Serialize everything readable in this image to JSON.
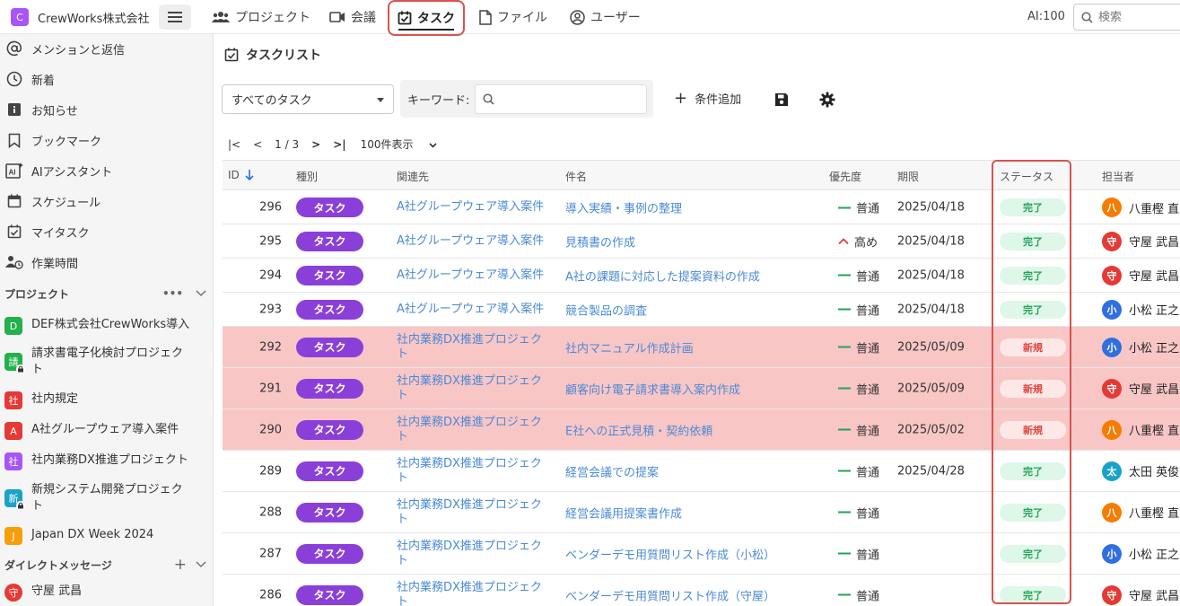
{
  "app": {
    "org_initial": "C",
    "org_name": "CrewWorks株式会社",
    "ai_count": "AI:100",
    "search_placeholder": "検索"
  },
  "topnav": {
    "project": "プロジェクト",
    "meeting": "会議",
    "task": "タスク",
    "file": "ファイル",
    "user": "ユーザー"
  },
  "sidebar": {
    "items": [
      {
        "label": "メンションと返信",
        "icon": "at-icon"
      },
      {
        "label": "新着",
        "icon": "clock-icon"
      },
      {
        "label": "お知らせ",
        "icon": "info-icon"
      },
      {
        "label": "ブックマーク",
        "icon": "bookmark-icon"
      },
      {
        "label": "AIアシスタント",
        "icon": "ai-assistant-icon"
      },
      {
        "label": "スケジュール",
        "icon": "calendar-icon"
      },
      {
        "label": "マイタスク",
        "icon": "task-icon"
      },
      {
        "label": "作業時間",
        "icon": "work-time-icon"
      }
    ],
    "projects_heading": "プロジェクト",
    "projects": [
      {
        "initial": "D",
        "label": "DEF株式会社CrewWorks導入",
        "color": "#22b14c",
        "locked": false
      },
      {
        "initial": "請",
        "label": "請求書電子化検討プロジェクト",
        "color": "#22b14c",
        "locked": true
      },
      {
        "initial": "社",
        "label": "社内規定",
        "color": "#e53935",
        "locked": false
      },
      {
        "initial": "A",
        "label": "A社グループウェア導入案件",
        "color": "#e53935",
        "locked": false
      },
      {
        "initial": "社",
        "label": "社内業務DX推進プロジェクト",
        "color": "#a855f7",
        "locked": false
      },
      {
        "initial": "新",
        "label": "新規システム開発プロジェクト",
        "color": "#1aa3c8",
        "locked": true
      },
      {
        "initial": "J",
        "label": "Japan DX Week 2024",
        "color": "#f59e0b",
        "locked": false
      }
    ],
    "dm_heading": "ダイレクトメッセージ",
    "dm": [
      {
        "initial": "守",
        "label": "守屋 武昌",
        "color": "#e53935"
      }
    ]
  },
  "main": {
    "title": "タスクリスト",
    "filter_value": "すべてのタスク",
    "keyword_label": "キーワード:",
    "add_condition": "条件追加",
    "pager": {
      "first": "|<",
      "prev": "<",
      "page": "1 / 3",
      "next": ">",
      "last": ">|",
      "per_page": "100件表示"
    }
  },
  "table": {
    "headers": {
      "id": "ID",
      "type": "種別",
      "related": "関連先",
      "title": "件名",
      "priority": "優先度",
      "deadline": "期限",
      "status": "ステータス",
      "assignee": "担当者"
    },
    "rows": [
      {
        "id": "296",
        "type": "タスク",
        "related": "A社グループウェア導入案件",
        "title": "導入実績・事例の整理",
        "priority": "普通",
        "priority_level": "normal",
        "deadline": "2025/04/18",
        "status": "完了",
        "status_kind": "done",
        "assignee_initial": "八",
        "assignee": "八重樫 直",
        "avatar_color": "#f57c00",
        "highlight": false
      },
      {
        "id": "295",
        "type": "タスク",
        "related": "A社グループウェア導入案件",
        "title": "見積書の作成",
        "priority": "高め",
        "priority_level": "high",
        "deadline": "2025/04/18",
        "status": "完了",
        "status_kind": "done",
        "assignee_initial": "守",
        "assignee": "守屋 武昌",
        "avatar_color": "#e53935",
        "highlight": false
      },
      {
        "id": "294",
        "type": "タスク",
        "related": "A社グループウェア導入案件",
        "title": "A社の課題に対応した提案資料の作成",
        "priority": "普通",
        "priority_level": "normal",
        "deadline": "2025/04/18",
        "status": "完了",
        "status_kind": "done",
        "assignee_initial": "守",
        "assignee": "守屋 武昌",
        "avatar_color": "#e53935",
        "highlight": false
      },
      {
        "id": "293",
        "type": "タスク",
        "related": "A社グループウェア導入案件",
        "title": "競合製品の調査",
        "priority": "普通",
        "priority_level": "normal",
        "deadline": "2025/04/18",
        "status": "完了",
        "status_kind": "done",
        "assignee_initial": "小",
        "assignee": "小松 正之",
        "avatar_color": "#2f6fe0",
        "highlight": false
      },
      {
        "id": "292",
        "type": "タスク",
        "related": "社内業務DX推進プロジェクト",
        "title": "社内マニュアル作成計画",
        "priority": "普通",
        "priority_level": "normal",
        "deadline": "2025/05/09",
        "status": "新規",
        "status_kind": "new",
        "assignee_initial": "小",
        "assignee": "小松 正之",
        "avatar_color": "#2f6fe0",
        "highlight": true
      },
      {
        "id": "291",
        "type": "タスク",
        "related": "社内業務DX推進プロジェクト",
        "title": "顧客向け電子請求書導入案内作成",
        "priority": "普通",
        "priority_level": "normal",
        "deadline": "2025/05/09",
        "status": "新規",
        "status_kind": "new",
        "assignee_initial": "守",
        "assignee": "守屋 武昌",
        "avatar_color": "#e53935",
        "highlight": true
      },
      {
        "id": "290",
        "type": "タスク",
        "related": "社内業務DX推進プロジェクト",
        "title": "E社への正式見積・契約依頼",
        "priority": "普通",
        "priority_level": "normal",
        "deadline": "2025/05/02",
        "status": "新規",
        "status_kind": "new",
        "assignee_initial": "八",
        "assignee": "八重樫 直",
        "avatar_color": "#f57c00",
        "highlight": true
      },
      {
        "id": "289",
        "type": "タスク",
        "related": "社内業務DX推進プロジェクト",
        "title": "経営会議での提案",
        "priority": "普通",
        "priority_level": "normal",
        "deadline": "2025/04/28",
        "status": "完了",
        "status_kind": "done",
        "assignee_initial": "太",
        "assignee": "太田 英俊",
        "avatar_color": "#1aa3c8",
        "highlight": false
      },
      {
        "id": "288",
        "type": "タスク",
        "related": "社内業務DX推進プロジェクト",
        "title": "経営会議用提案書作成",
        "priority": "普通",
        "priority_level": "normal",
        "deadline": "",
        "status": "完了",
        "status_kind": "done",
        "assignee_initial": "八",
        "assignee": "八重樫 直",
        "avatar_color": "#f57c00",
        "highlight": false
      },
      {
        "id": "287",
        "type": "タスク",
        "related": "社内業務DX推進プロジェクト",
        "title": "ベンダーデモ用質問リスト作成（小松）",
        "priority": "普通",
        "priority_level": "normal",
        "deadline": "",
        "status": "完了",
        "status_kind": "done",
        "assignee_initial": "小",
        "assignee": "小松 正之",
        "avatar_color": "#2f6fe0",
        "highlight": false
      },
      {
        "id": "286",
        "type": "タスク",
        "related": "社内業務DX推進プロジェクト",
        "title": "ベンダーデモ用質問リスト作成（守屋）",
        "priority": "普通",
        "priority_level": "normal",
        "deadline": "",
        "status": "完了",
        "status_kind": "done",
        "assignee_initial": "守",
        "assignee": "守屋 武昌",
        "avatar_color": "#e53935",
        "highlight": false
      }
    ]
  }
}
